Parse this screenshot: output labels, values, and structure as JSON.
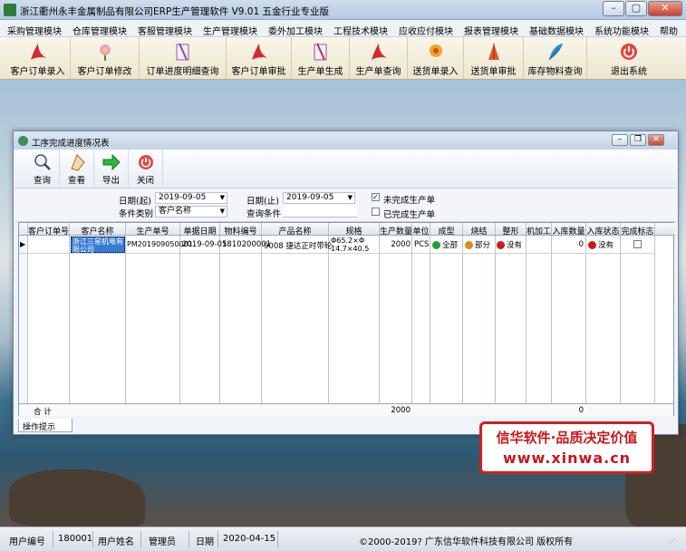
{
  "window": {
    "title": "浙江衢州永丰金属制品有限公司ERP生产管理软件  V9.01 五金行业专业版"
  },
  "menu": [
    "采购管理模块",
    "仓库管理模块",
    "客服管理模块",
    "生产管理模块",
    "委外加工模块",
    "工程技术模块",
    "应收应付模块",
    "报表管理模块",
    "基础数据模块",
    "系统功能模块",
    "帮助"
  ],
  "toolbar": [
    {
      "label": "客户订单录入",
      "icon": "pdf-icon"
    },
    {
      "label": "客户订单修改",
      "icon": "flower-icon"
    },
    {
      "label": "订单进度明细查询",
      "icon": "clip-icon"
    },
    {
      "label": "客户订单审批",
      "icon": "pdf-icon"
    },
    {
      "label": "生产单生成",
      "icon": "clip-icon"
    },
    {
      "label": "生产单查询",
      "icon": "pdf-icon"
    },
    {
      "label": "送货单录入",
      "icon": "flower-icon"
    },
    {
      "label": "送货单审批",
      "icon": "flower-icon"
    },
    {
      "label": "库存物料查询",
      "icon": "feather-icon"
    },
    {
      "label": "退出系统",
      "icon": "power-icon"
    }
  ],
  "child": {
    "title": "工序完成进度情况表",
    "tools": [
      {
        "label": "查询"
      },
      {
        "label": "查看"
      },
      {
        "label": "导出"
      },
      {
        "label": "关闭"
      }
    ],
    "filter": {
      "date_from_label": "日期(起)",
      "date_from": "2019-09-05",
      "date_to_label": "日期(止)",
      "date_to": "2019-09-05",
      "cond_type_label": "条件类别",
      "cond_type": "客户名称",
      "cond_label": "查询条件",
      "unfinished_label": "未完成生产单",
      "unfinished_checked": "✓",
      "finished_label": "已完成生产单"
    },
    "columns": [
      "客户订单号",
      "客户名称",
      "生产单号",
      "单据日期",
      "物料编号",
      "产品名称",
      "规格",
      "生产数量",
      "单位",
      "成型",
      "烧结",
      "整形",
      "机加工",
      "入库数量",
      "入库状态",
      "完成标志"
    ],
    "row": {
      "order_no": "",
      "customer": "浙江三星机电有限公司",
      "prod_no": "PM201909050001",
      "date": "2019-09-05",
      "material": "1810200001",
      "product": "9008 捷达正时带轮",
      "spec_l1": "Φ65.2×Φ",
      "spec_l2": "14.7×40.5",
      "qty": "2000",
      "unit": "PCS",
      "forming": "全部",
      "sintering": "部分",
      "shaping": "没有",
      "machining": "",
      "in_qty": "0",
      "in_status": "没有"
    },
    "total": {
      "label": "合 计",
      "qty": "2000",
      "in_qty": "0"
    },
    "tab_label": "操作提示",
    "colors": {
      "green": "#1fa234",
      "orange": "#e48a10",
      "red": "#cc1a1a"
    }
  },
  "promo": {
    "line1": "信华软件·品质决定价值",
    "line2": "www.xinwa.cn"
  },
  "status": {
    "user_no_label": "用户编号",
    "user_no": "180001",
    "user_name_label": "用户姓名",
    "user_name": "管理员",
    "date_label": "日期",
    "date": "2020-04-15",
    "copyright": "©2000-2019?  广东信华软件科技有限公司   版权所有"
  }
}
